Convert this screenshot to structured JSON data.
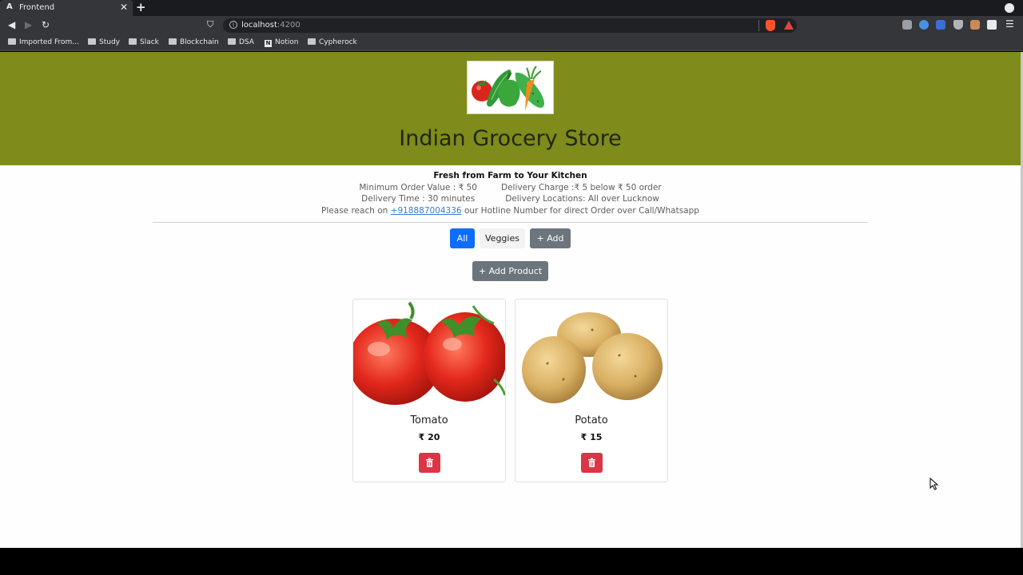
{
  "browser": {
    "tab_favicon": "A",
    "tab_title": "Frontend",
    "tab_close": "✕",
    "new_tab": "+",
    "back": "◀",
    "forward": "▶",
    "reload": "↻",
    "bookmark": "⛉",
    "url_host": "localhost",
    "url_port": ":4200",
    "menu": "☰",
    "bookmarks": [
      "Imported From...",
      "Study",
      "Slack",
      "Blockchain",
      "DSA",
      "Notion",
      "Cypherock"
    ]
  },
  "header": {
    "title": "Indian Grocery Store",
    "colors": {
      "header_bg": "#7f8b1a"
    }
  },
  "info": {
    "tagline": "Fresh from Farm to Your Kitchen",
    "min_order": "Minimum Order Value : ₹ 50",
    "delivery_charge": "Delivery Charge :₹ 5 below ₹ 50 order",
    "delivery_time": "Delivery Time : 30 minutes",
    "delivery_locations": "Delivery Locations: All over Lucknow",
    "hotline_prefix": "Please reach on",
    "hotline_number": "+918887004336",
    "hotline_suffix": "our Hotline Number for direct Order over Call/Whatsapp"
  },
  "filters": {
    "all": "All",
    "veggies": "Veggies",
    "add": "+ Add"
  },
  "add_product_label": "+ Add Product",
  "products": [
    {
      "name": "Tomato",
      "price": "₹ 20",
      "image": "tomato-image"
    },
    {
      "name": "Potato",
      "price": "₹ 15",
      "image": "potato-image"
    }
  ],
  "colors": {
    "primary": "#0d6efd",
    "secondary": "#6c757d",
    "danger": "#dc3545"
  }
}
